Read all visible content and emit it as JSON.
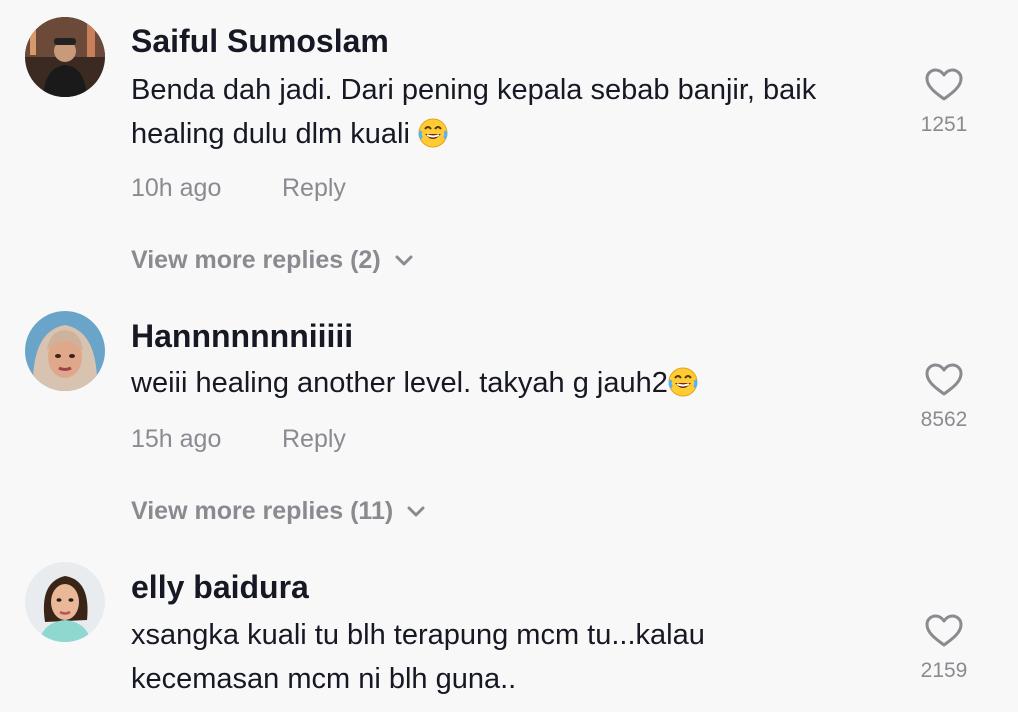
{
  "comments": [
    {
      "username": "Saiful Sumoslam",
      "text": "Benda dah jadi. Dari pening kepala sebab banjir, baik\nhealing dulu dlm kuali",
      "emoji": "face-with-tears-of-joy",
      "time": "10h ago",
      "reply_label": "Reply",
      "likes": "1251",
      "more_replies": "View more replies (2)"
    },
    {
      "username": "Hannnnnnniiiii",
      "text": "weiii healing another level. takyah g jauh2",
      "emoji": "face-with-tears-of-joy",
      "time": "15h ago",
      "reply_label": "Reply",
      "likes": "8562",
      "more_replies": "View more replies (11)"
    },
    {
      "username": "elly baidura",
      "text": "xsangka kuali tu blh terapung mcm tu...kalau\nkecemasan mcm ni blh guna..",
      "likes": "2159"
    }
  ],
  "colors": {
    "background": "#f8f8f8",
    "primary_text": "#161823",
    "secondary_text": "#8a8b91"
  },
  "icons": {
    "like": "heart-outline-icon",
    "expand": "chevron-down-icon"
  }
}
